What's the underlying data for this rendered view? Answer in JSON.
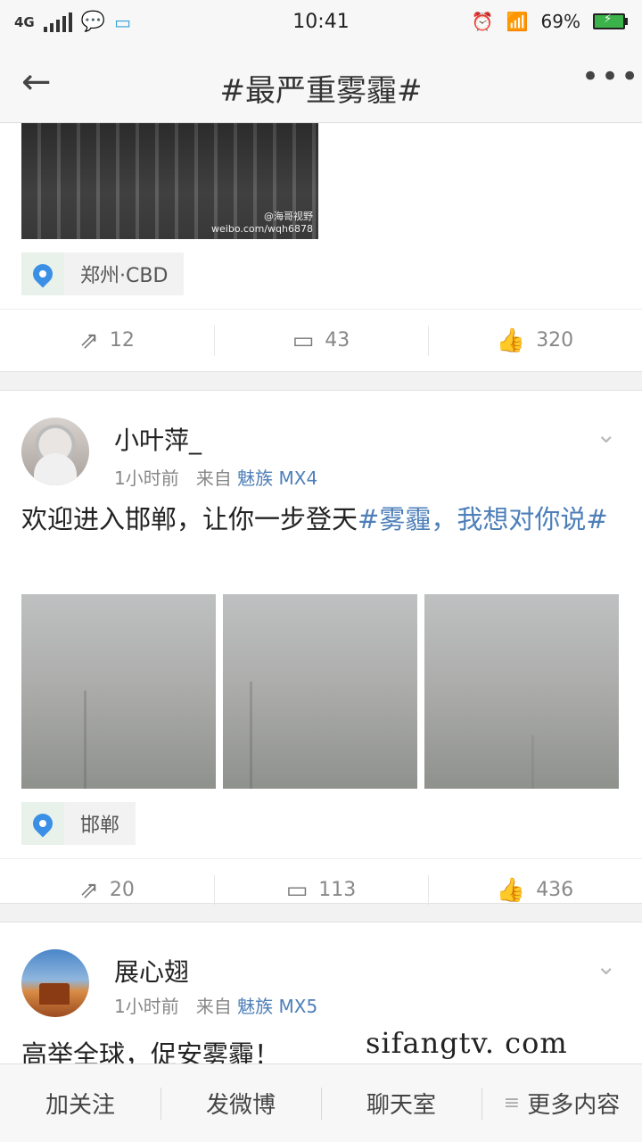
{
  "status_bar": {
    "network": "4G",
    "time": "10:41",
    "battery_percent": "69%",
    "battery_level": 0.69,
    "icons": [
      "signal-icon",
      "wechat-icon",
      "image-icon",
      "alarm-icon",
      "wifi-icon",
      "battery-icon"
    ]
  },
  "header": {
    "title": "#最严重雾霾#",
    "back_icon": "←",
    "more_icon": "•••"
  },
  "posts": [
    {
      "image_watermark": [
        "@海哥视野",
        "weibo.com/wqh6878"
      ],
      "location": "郑州·CBD",
      "actions": {
        "repost": "12",
        "comment": "43",
        "like": "320"
      }
    },
    {
      "username": "小叶萍_",
      "time": "1小时前",
      "from_label": "来自",
      "source": "魅族 MX4",
      "text_plain": "欢迎进入邯郸，让你一步登天",
      "text_topic": "#雾霾，我想对你说#",
      "location": "邯郸",
      "actions": {
        "repost": "20",
        "comment": "113",
        "like": "436"
      }
    },
    {
      "username": "展心翅",
      "time": "1小时前",
      "from_label": "来自",
      "source": "魅族 MX5",
      "text_partial": "高举全球，促安雾霾！"
    }
  ],
  "watermark_text": "sifangtv. com",
  "bottom_tabs": [
    "加关注",
    "发微博",
    "聊天室",
    "更多内容"
  ],
  "colors": {
    "link": "#4e7fb8",
    "battery": "#3cb34a"
  }
}
